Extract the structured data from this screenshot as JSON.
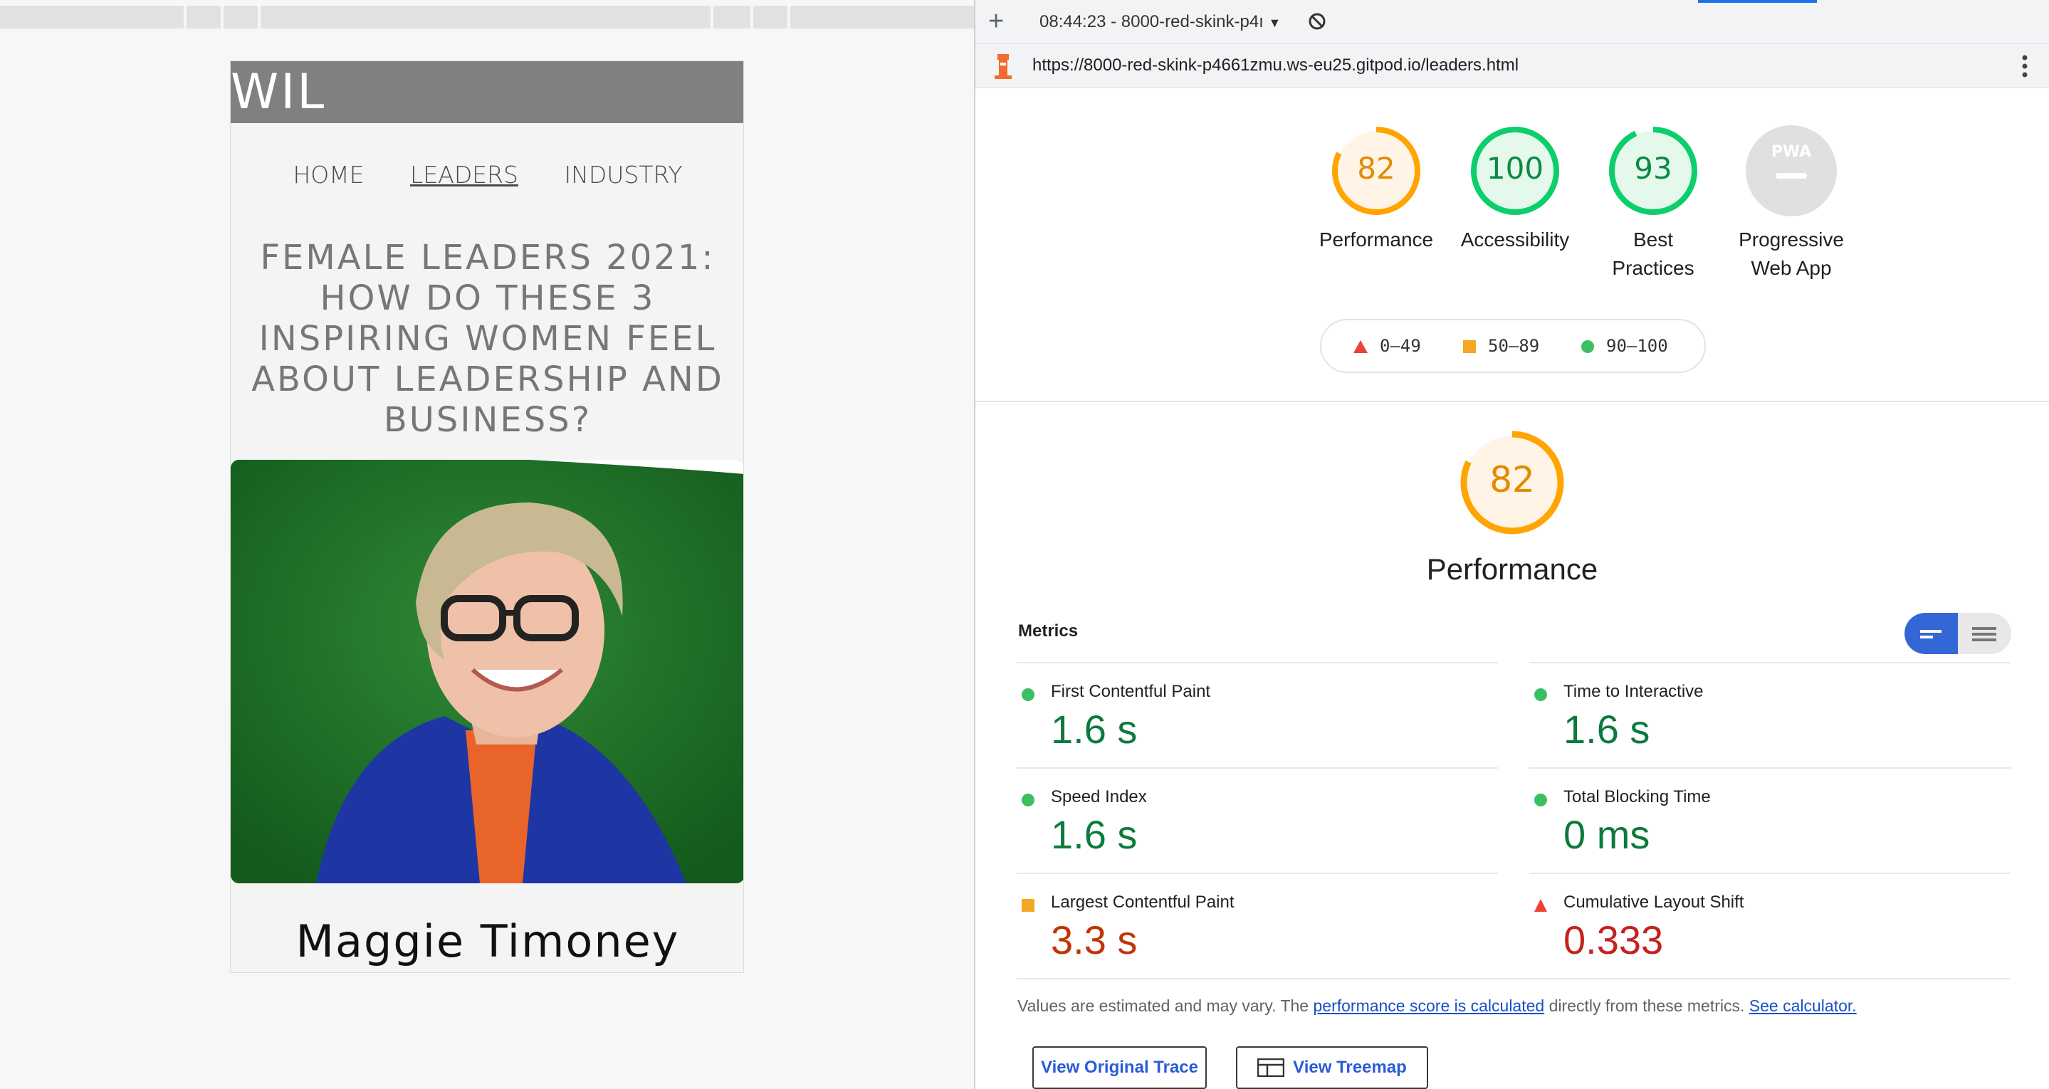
{
  "left": {
    "site_logo": "WIL",
    "nav": [
      {
        "label": "HOME",
        "active": false
      },
      {
        "label": "LEADERS",
        "active": true
      },
      {
        "label": "INDUSTRY",
        "active": false
      }
    ],
    "article_title": "FEMALE LEADERS 2021: HOW DO THESE 3 INSPIRING WOMEN FEEL ABOUT LEADERSHIP AND BUSINESS?",
    "leader_name": "Maggie Timoney"
  },
  "devtools": {
    "report_selector": "08:44:23 - 8000-red-skink-p4ı",
    "url": "https://8000-red-skink-p4661zmu.ws-eu25.gitpod.io/leaders.html"
  },
  "gauges": [
    {
      "score": "82",
      "label": "Performance",
      "status": "average",
      "fraction": 0.82
    },
    {
      "score": "100",
      "label": "Accessibility",
      "status": "pass",
      "fraction": 1.0
    },
    {
      "score": "93",
      "label": "Best Practices",
      "status": "pass",
      "fraction": 0.93
    },
    {
      "score": "PWA",
      "label": "Progressive Web App",
      "status": "na",
      "fraction": 0
    }
  ],
  "legend": [
    {
      "range": "0–49",
      "shape": "triangle",
      "color": "#eb4335"
    },
    {
      "range": "50–89",
      "shape": "square",
      "color": "#f5a623"
    },
    {
      "range": "90–100",
      "shape": "circle",
      "color": "#3cbf62"
    }
  ],
  "performance": {
    "score": "82",
    "label": "Performance",
    "fraction": 0.82
  },
  "metrics_title": "Metrics",
  "metrics": [
    {
      "name": "First Contentful Paint",
      "value": "1.6 s",
      "status": "pass"
    },
    {
      "name": "Time to Interactive",
      "value": "1.6 s",
      "status": "pass"
    },
    {
      "name": "Speed Index",
      "value": "1.6 s",
      "status": "pass"
    },
    {
      "name": "Total Blocking Time",
      "value": "0 ms",
      "status": "pass"
    },
    {
      "name": "Largest Contentful Paint",
      "value": "3.3 s",
      "status": "average"
    },
    {
      "name": "Cumulative Layout Shift",
      "value": "0.333",
      "status": "fail"
    }
  ],
  "note": {
    "prefix": "Values are estimated and may vary. The ",
    "link1": "performance score is calculated",
    "middle": " directly from these metrics. ",
    "link2": "See calculator."
  },
  "buttons": {
    "view_trace": "View Original Trace",
    "view_treemap": "View Treemap"
  },
  "colors": {
    "pass": "#0cce6b",
    "average": "#ffa400",
    "fail": "#ff4e42",
    "accent": "#1a73e8"
  }
}
